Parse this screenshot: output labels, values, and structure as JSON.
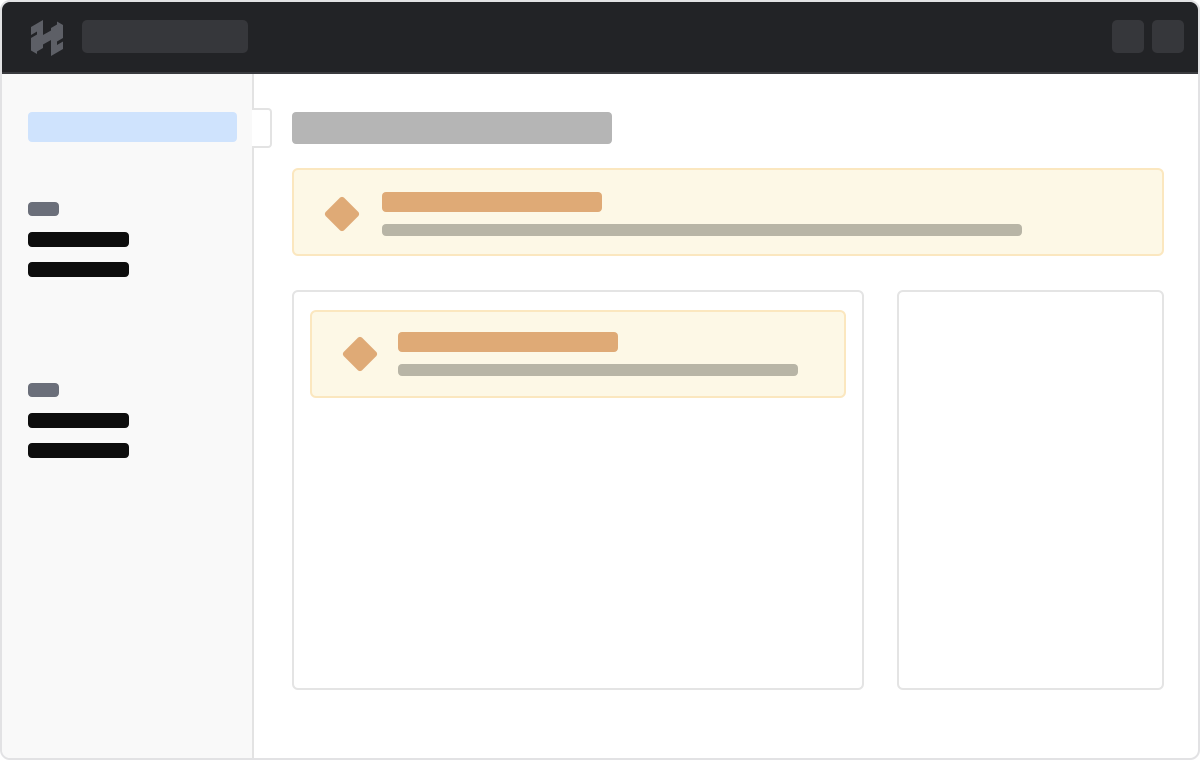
{
  "app": {
    "title": "",
    "search": {
      "value": ""
    }
  },
  "colors": {
    "topbar": "#222326",
    "sidebar": "#f9f9f9",
    "active_nav": "#cfe3fd",
    "warning_bg": "#fdf8e6",
    "warning_border": "#fbe7bf",
    "warning_accent": "#dfaa76",
    "skeleton_text": "#0d0d0d",
    "skeleton_muted": "#b5b5b5"
  },
  "icons": {
    "logo": "hashicorp-logo-icon",
    "alert": "warning-diamond-icon"
  },
  "sidebar": {
    "sections": [
      {
        "label": "",
        "items": [
          {
            "label": ""
          },
          {
            "label": ""
          }
        ]
      },
      {
        "label": "",
        "items": [
          {
            "label": ""
          },
          {
            "label": ""
          }
        ]
      }
    ]
  },
  "main": {
    "title": "",
    "page_alert": {
      "title": "",
      "description": ""
    },
    "card_alert": {
      "title": "",
      "description": ""
    }
  }
}
